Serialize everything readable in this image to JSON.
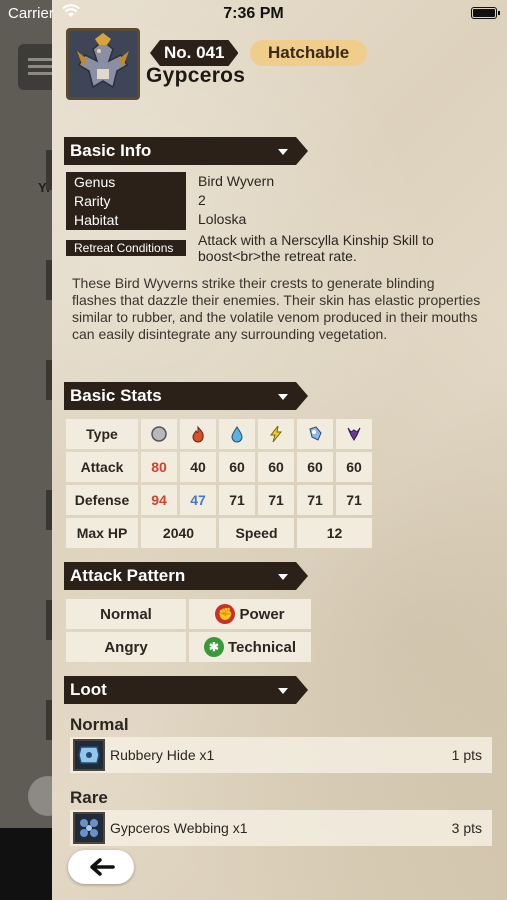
{
  "status_bar": {
    "carrier": "Carrier",
    "time": "7:36 PM"
  },
  "background": {
    "partial_label": "Yi"
  },
  "monster": {
    "number": "No. 041",
    "badge": "Hatchable",
    "name": "Gypceros",
    "icon": "gypceros-portrait-icon"
  },
  "basic_info": {
    "title": "Basic Info",
    "rows": [
      {
        "label": "Genus",
        "value": "Bird Wyvern"
      },
      {
        "label": "Rarity",
        "value": "2"
      },
      {
        "label": "Habitat",
        "value": "Loloska"
      }
    ],
    "retreat_label": "Retreat Conditions",
    "retreat_value": "Attack with a Nerscylla Kinship Skill to boost<br>the retreat rate.",
    "description": "These Bird Wyverns strike their crests to generate blinding flashes that dazzle their enemies. Their skin has elastic properties similar to rubber, and the volatile venom produced in their mouths can easily disintegrate any surrounding vegetation."
  },
  "basic_stats": {
    "title": "Basic Stats",
    "type_label": "Type",
    "type_icons": [
      "neutral-icon",
      "fire-icon",
      "water-icon",
      "thunder-icon",
      "ice-icon",
      "dragon-icon"
    ],
    "attack_label": "Attack",
    "attack": [
      "80",
      "40",
      "60",
      "60",
      "60",
      "60"
    ],
    "defense_label": "Defense",
    "defense": [
      "94",
      "47",
      "71",
      "71",
      "71",
      "71"
    ],
    "max_hp_label": "Max HP",
    "max_hp": "2040",
    "speed_label": "Speed",
    "speed": "12",
    "highlight_red": "#d04030",
    "highlight_blue": "#4a78c9"
  },
  "attack_pattern": {
    "title": "Attack Pattern",
    "normal_label": "Normal",
    "normal_value": "Power",
    "angry_label": "Angry",
    "angry_value": "Technical",
    "power_color": "#c8302a",
    "technical_color": "#3a9a3a"
  },
  "loot": {
    "title": "Loot",
    "normal_heading": "Normal",
    "normal_item": {
      "name": "Rubbery Hide x1",
      "pts": "1 pts"
    },
    "rare_heading": "Rare",
    "rare_item": {
      "name": "Gypceros Webbing x1",
      "pts": "3 pts"
    }
  }
}
